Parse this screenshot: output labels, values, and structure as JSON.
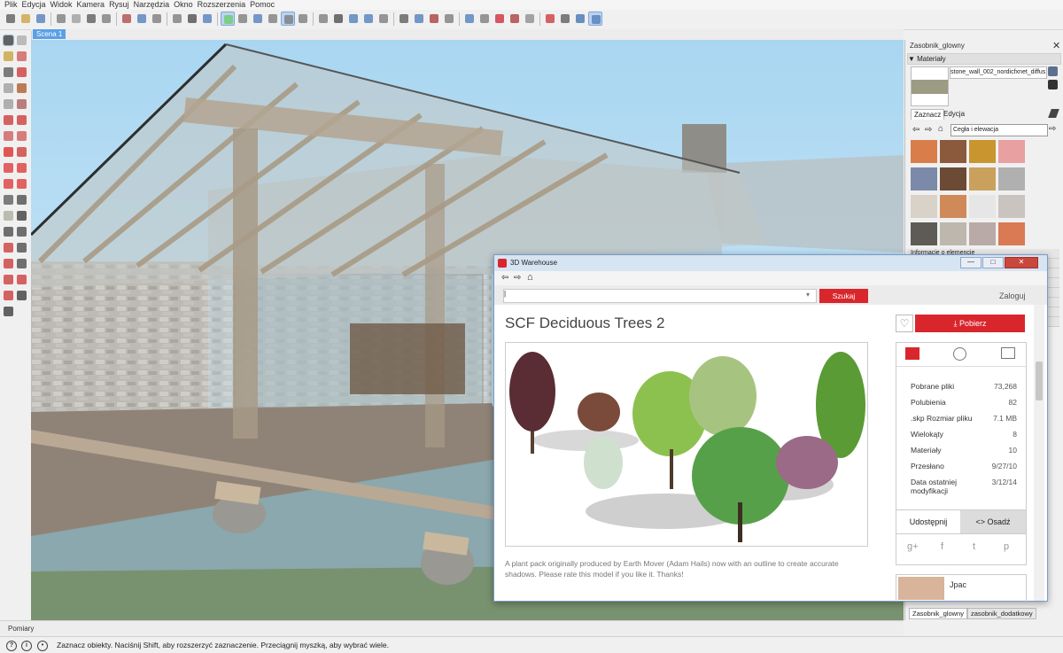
{
  "menu": [
    "Plik",
    "Edycja",
    "Widok",
    "Kamera",
    "Rysuj",
    "Narzędzia",
    "Okno",
    "Rozszerzenia",
    "Pomoc"
  ],
  "scene_tab": "Scena 1",
  "measurements_label": "Pomiary",
  "status_text": "Zaznacz obiekty. Naciśnij Shift, aby rozszerzyć zaznaczenie. Przeciągnij myszką, aby wybrać wiele.",
  "tray": {
    "title": "Zasobnik_glowny",
    "close": "✕",
    "materials_header": "▼ Materiały",
    "material_name": "stone_wall_002_nordicfxnet_diffus",
    "tab_select": "Zaznacz",
    "tab_edit": "Edycja",
    "collection": "Cegła i elewacja",
    "collapsed": [
      "Informacje o elemencie",
      "",
      "",
      "",
      "",
      "",
      "",
      ""
    ],
    "bottom_tabs": [
      "Zasobnik_glowny",
      "zasobnik_dodatkowy"
    ],
    "swatch_colors": [
      "#d97d4b",
      "#8b5a3c",
      "#c9952f",
      "#e8a0a0",
      "#7a8aa8",
      "#6b4a36",
      "#c9a15c",
      "#b0b0b0",
      "#d9d2c8",
      "#d08a5a",
      "#e6e6e6",
      "#c9c4c0",
      "#5e5a55",
      "#bdb7ae",
      "#b9aaa8",
      "#d97a55"
    ]
  },
  "warehouse": {
    "window_title": "3D Warehouse",
    "win_min": "—",
    "win_max": "□",
    "win_close": "✕",
    "search_value": "|",
    "search_button": "Szukaj",
    "login": "Zaloguj",
    "model_title": "SCF Deciduous Trees 2",
    "download": "Pobierz",
    "stats": [
      {
        "label": "Pobrane pliki",
        "value": "73,268"
      },
      {
        "label": "Polubienia",
        "value": "82"
      },
      {
        "label": ".skp Rozmiar pliku",
        "value": "7.1 MB"
      },
      {
        "label": "Wielokąty",
        "value": "8"
      },
      {
        "label": "Materiały",
        "value": "10"
      },
      {
        "label": "Przesłano",
        "value": "9/27/10"
      },
      {
        "label": "Data ostatniej modyfikacji",
        "value": "3/12/14"
      }
    ],
    "share": "Udostępnij",
    "embed": "<> Osadź",
    "social": [
      "g+",
      "f",
      "t",
      "p"
    ],
    "description": "A plant pack originally produced by Earth Mover (Adam Hails) now with an outline to create accurate shadows. Please rate this model if you like it. Thanks!",
    "username": "Jpac"
  },
  "colors": {
    "accent_red": "#d9262d",
    "selection_blue": "#5aa0e6"
  }
}
